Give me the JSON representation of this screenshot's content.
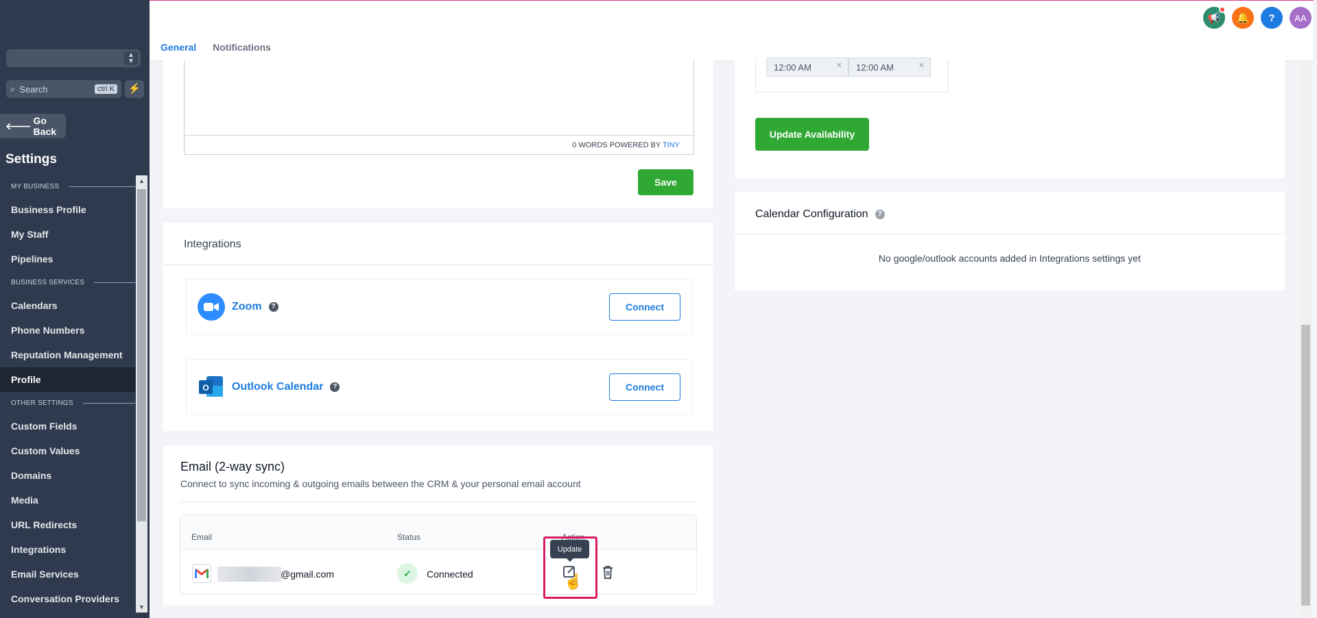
{
  "sidebar": {
    "search_placeholder": "Search",
    "search_shortcut": "ctrl K",
    "go_back": "Go Back",
    "title": "Settings",
    "sections": [
      {
        "label": "MY BUSINESS",
        "items": [
          "Business Profile",
          "My Staff",
          "Pipelines"
        ]
      },
      {
        "label": "BUSINESS SERVICES",
        "items": [
          "Calendars",
          "Phone Numbers",
          "Reputation Management",
          "Profile"
        ]
      },
      {
        "label": "OTHER SETTINGS",
        "items": [
          "Custom Fields",
          "Custom Values",
          "Domains",
          "Media",
          "URL Redirects",
          "Integrations",
          "Email Services",
          "Conversation Providers"
        ]
      }
    ],
    "active_item": "Profile"
  },
  "header": {
    "tabs": [
      {
        "label": "General",
        "active": true
      },
      {
        "label": "Notifications",
        "active": false
      }
    ],
    "icons": [
      "megaphone-icon",
      "bell-icon",
      "help-icon",
      "avatar"
    ],
    "avatar_initials": "AA",
    "colors": {
      "megaphone": "#2e8b6e",
      "bell": "#f97316",
      "help": "#1d7ce0",
      "avatar": "#a66ec9"
    }
  },
  "editor": {
    "word_count": "0 WORDS",
    "powered_by": "POWERED BY",
    "brand": "TINY",
    "save_label": "Save"
  },
  "integrations": {
    "title": "Integrations",
    "items": [
      {
        "name": "Zoom",
        "button": "Connect"
      },
      {
        "name": "Outlook Calendar",
        "button": "Connect"
      }
    ]
  },
  "email_sync": {
    "title": "Email (2-way sync)",
    "subtitle": "Connect to sync incoming & outgoing emails between the CRM & your personal email account",
    "columns": [
      "Email",
      "Status",
      "Action"
    ],
    "row": {
      "email_suffix": "@gmail.com",
      "status": "Connected"
    },
    "tooltip": "Update"
  },
  "availability": {
    "start_time": "12:00 AM",
    "end_time": "12:00 AM",
    "button": "Update Availability"
  },
  "calendar_config": {
    "title": "Calendar Configuration",
    "empty_message": "No google/outlook accounts added in Integrations settings yet"
  },
  "colors": {
    "accent_blue": "#1d7ce0",
    "primary_green": "#30a934",
    "sidebar_bg": "#2f3a4e",
    "highlight": "#d81b60"
  }
}
